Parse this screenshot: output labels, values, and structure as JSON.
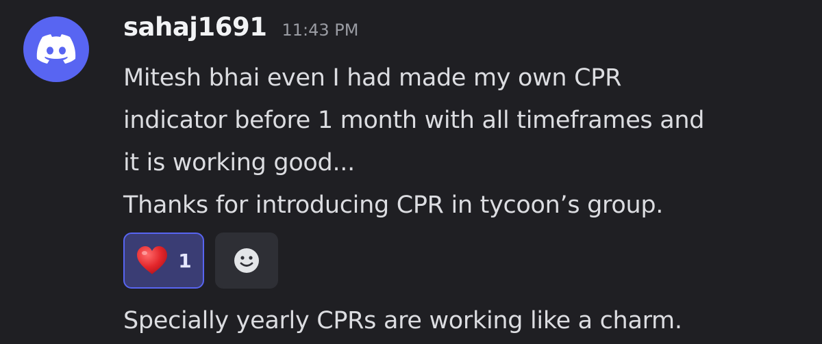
{
  "message": {
    "author": "sahaj1691",
    "timestamp": "11:43 PM",
    "avatar_icon": "discord-logo-icon",
    "avatar_color": "#5865f2",
    "lines": [
      "Mitesh bhai even I had made my own CPR",
      "indicator before 1 month with all timeframes and",
      "it is working good...",
      "Thanks for introducing CPR in tycoon’s group."
    ],
    "reactions": [
      {
        "emoji": "heart-emoji-icon",
        "count": "1",
        "reacted": true
      }
    ],
    "add_reaction_icon": "smiley-face-icon"
  },
  "followup_message": {
    "text": "Specially yearly CPRs are working like a charm."
  },
  "colors": {
    "background": "#1f1f23",
    "accent": "#5865f2",
    "reaction_bg": "#3a3d74",
    "text": "#dcdde1",
    "timestamp": "#9a9ca3"
  }
}
